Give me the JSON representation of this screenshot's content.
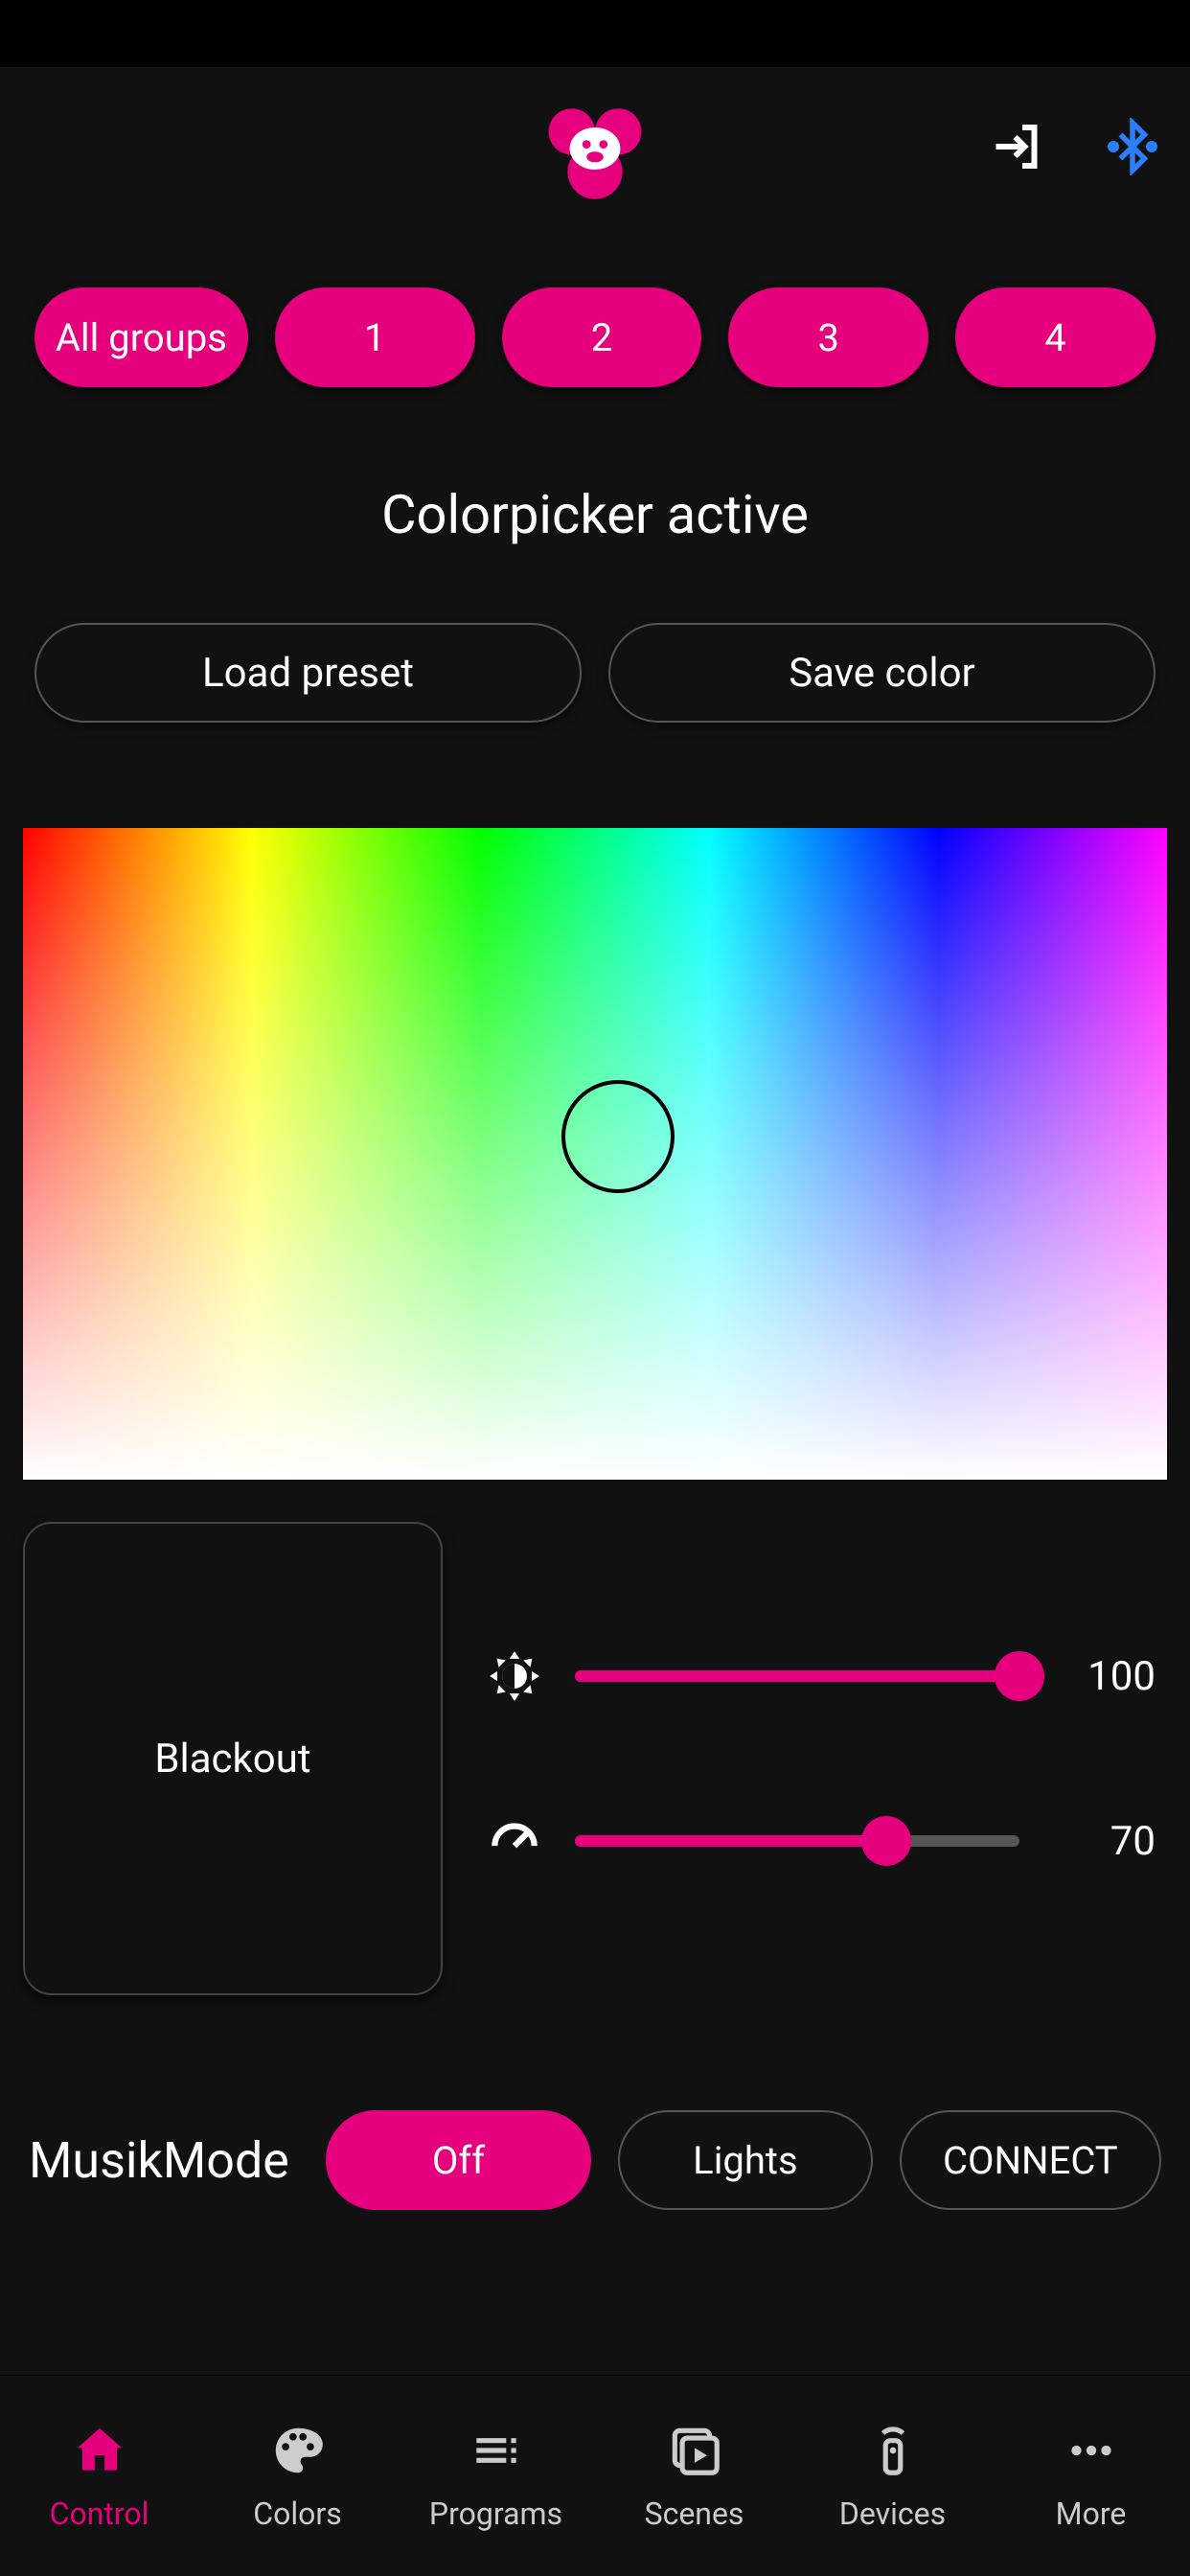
{
  "colors": {
    "accent": "#e6007e",
    "bluetooth": "#2a7fff"
  },
  "groups": {
    "all": "All groups",
    "items": [
      "1",
      "2",
      "3",
      "4"
    ]
  },
  "title": "Colorpicker active",
  "buttons": {
    "load": "Load preset",
    "save": "Save color",
    "blackout": "Blackout"
  },
  "sliders": {
    "brightness": 100,
    "speed": 70
  },
  "music": {
    "label": "MusikMode",
    "off": "Off",
    "lights": "Lights",
    "connect": "CONNECT"
  },
  "tabs": [
    "Control",
    "Colors",
    "Programs",
    "Scenes",
    "Devices",
    "More"
  ]
}
